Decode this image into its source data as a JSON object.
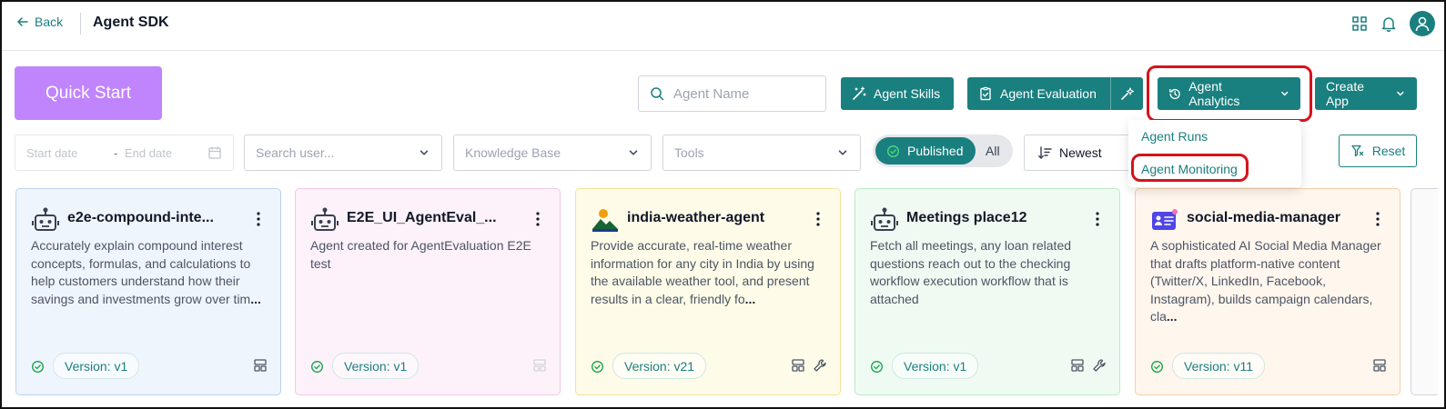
{
  "header": {
    "back_label": "Back",
    "title": "Agent SDK"
  },
  "toolbar": {
    "quick_start_label": "Quick Start",
    "search_placeholder": "Agent Name",
    "agent_skills_label": "Agent Skills",
    "agent_evaluation_label": "Agent Evaluation",
    "agent_analytics_label": "Agent Analytics",
    "create_app_label": "Create App"
  },
  "analytics_menu": {
    "items": [
      "Agent Runs",
      "Agent Monitoring"
    ]
  },
  "filters": {
    "start_date_placeholder": "Start date",
    "date_separator": "-",
    "end_date_placeholder": "End date",
    "user_placeholder": "Search user...",
    "knowledge_base_placeholder": "Knowledge Base",
    "tools_placeholder": "Tools",
    "toggle_published": "Published",
    "toggle_all": "All",
    "sort_label": "Newest",
    "reset_label": "Reset"
  },
  "colors": {
    "accent": "#1a7f7f",
    "quick_start": "#c084fc",
    "highlight": "#d6131b"
  },
  "cards": [
    {
      "title": "e2e-compound-inte...",
      "icon": "robot-icon",
      "description": "Accurately explain compound interest concepts, formulas, and calculations to help customers understand how their savings and investments grow over tim",
      "truncation": "...",
      "version": "Version: v1",
      "tools": [
        "layout-icon"
      ]
    },
    {
      "title": "E2E_UI_AgentEval_...",
      "icon": "robot-icon",
      "description": "Agent created for AgentEvaluation E2E test",
      "truncation": "",
      "version": "Version: v1",
      "tools": [
        "layout-icon"
      ]
    },
    {
      "title": "india-weather-agent",
      "icon": "landscape-icon",
      "description": "Provide accurate, real-time weather information for any city in India by using the available weather tool, and present results in a clear, friendly fo",
      "truncation": "...",
      "version": "Version: v21",
      "tools": [
        "layout-icon",
        "wrench-icon"
      ]
    },
    {
      "title": "Meetings place12",
      "icon": "robot-icon",
      "description": "Fetch all meetings, any loan related questions reach out to the checking workflow execution workflow that is attached",
      "truncation": "",
      "version": "Version: v1",
      "tools": [
        "layout-icon",
        "wrench-icon"
      ]
    },
    {
      "title": "social-media-manager",
      "icon": "id-card-icon",
      "description": "A sophisticated AI Social Media Manager that drafts platform-native content (Twitter/X, LinkedIn, Facebook, Instagram), builds campaign calendars, cla",
      "truncation": "...",
      "version": "Version: v11",
      "tools": [
        "layout-icon"
      ]
    }
  ]
}
